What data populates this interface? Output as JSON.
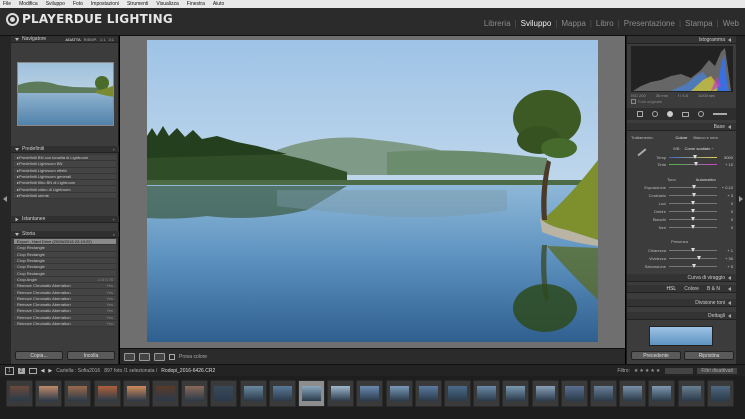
{
  "menu": [
    "File",
    "Modifica",
    "Sviluppo",
    "Foto",
    "Impostazioni",
    "Strumenti",
    "Visualizza",
    "Finestra",
    "Aiuto"
  ],
  "logo": {
    "text": "PLAYERDUE LIGHTING"
  },
  "modules": [
    {
      "label": "Libreria",
      "active": false
    },
    {
      "label": "Sviluppo",
      "active": true
    },
    {
      "label": "Mappa",
      "active": false
    },
    {
      "label": "Libro",
      "active": false
    },
    {
      "label": "Presentazione",
      "active": false
    },
    {
      "label": "Stampa",
      "active": false
    },
    {
      "label": "Web",
      "active": false
    }
  ],
  "left": {
    "navigator": {
      "title": "Navigatore",
      "zoom": [
        "ADATTA",
        "RIEMP.",
        "1:1",
        "3:1"
      ]
    },
    "presets": {
      "title": "Predefiniti",
      "items": [
        "Predefiniti BN con tonalità di Lightroom",
        "Predefiniti Lightroom BN",
        "Predefiniti Lightroom effetti",
        "Predefiniti Lightroom generali",
        "Predefiniti filtro BN di Lightroom",
        "Predefiniti video di Lightroom",
        "Predefiniti utente"
      ]
    },
    "snapshots": {
      "title": "Istantanee"
    },
    "history": {
      "title": "Storia",
      "items": [
        {
          "label": "Export - Hard Drive (20/06/2016 22:19:22)",
          "tag": "",
          "selected": true
        },
        {
          "label": "Crop Rectangle",
          "tag": ""
        },
        {
          "label": "Crop Rectangle",
          "tag": ""
        },
        {
          "label": "Crop Rectangle",
          "tag": ""
        },
        {
          "label": "Crop Rectangle",
          "tag": ""
        },
        {
          "label": "Crop Rectangle",
          "tag": ""
        },
        {
          "label": "Crop Angle",
          "tag": "-0.0  0.78"
        },
        {
          "label": "Remove Chromatic Aberration",
          "tag": "Yes"
        },
        {
          "label": "Remove Chromatic Aberration",
          "tag": "Yes"
        },
        {
          "label": "Remove Chromatic Aberration",
          "tag": "Yes"
        },
        {
          "label": "Remove Chromatic Aberration",
          "tag": "Yes"
        },
        {
          "label": "Remove Chromatic Aberration",
          "tag": "Yes"
        },
        {
          "label": "Remove Chromatic Aberration",
          "tag": "Yes"
        },
        {
          "label": "Remove Chromatic Aberration",
          "tag": "Yes"
        }
      ]
    },
    "copy_label": "Copia...",
    "paste_label": "Incolla"
  },
  "toolbar": {
    "soft_proof": "Prova colore"
  },
  "right": {
    "histogram_title": "Istogramma",
    "histogram_info": [
      "ISO 200",
      "35 mm",
      "f / 5.6",
      "1/200 sec"
    ],
    "original_photo": "Foto originale",
    "basic_title": "Base",
    "treatment_label": "Trattamento:",
    "color_label": "Colore",
    "bw_label": "Bianco e nero",
    "wb_label": "WB:",
    "wb_value": "Come scattato ÷",
    "temp_label": "Temp",
    "temp_value": "5000",
    "tint_label": "Tinta",
    "tint_value": "+ 10",
    "tone_label": "Tono",
    "auto_label": "Automatico",
    "sliders": [
      {
        "label": "Esposizione",
        "value": "+ 0,10",
        "pos": 0.52
      },
      {
        "label": "Contrasto",
        "value": "+ 3",
        "pos": 0.52
      },
      {
        "label": "Luci",
        "value": "0",
        "pos": 0.5
      },
      {
        "label": "Ombre",
        "value": "0",
        "pos": 0.5
      },
      {
        "label": "Bianchi",
        "value": "0",
        "pos": 0.5
      },
      {
        "label": "Neri",
        "value": "0",
        "pos": 0.5
      }
    ],
    "presence_label": "Presenza",
    "presence": [
      {
        "label": "Chiarezza",
        "value": "+ 1",
        "pos": 0.51
      },
      {
        "label": "Vividezza",
        "value": "+ 30",
        "pos": 0.62
      },
      {
        "label": "Saturazione",
        "value": "+ 5",
        "pos": 0.52
      }
    ],
    "tone_curve": "Curva di viraggio",
    "hsl": [
      "HSL",
      "Colore",
      "B & N"
    ],
    "split_tone": "Divisione toni",
    "detail": "Dettagli",
    "prev_label": "Precedente",
    "reset_label": "Ripristina"
  },
  "filmstrip": {
    "folder": "Cartella : Sofia2016",
    "count": "897 foto /1 selezionata /",
    "filename": "Rodopi_2016-6426.CR2",
    "filter_label": "Filtro:",
    "filter_value": "Filtri disattivati",
    "page1": "1",
    "page2": "2"
  }
}
